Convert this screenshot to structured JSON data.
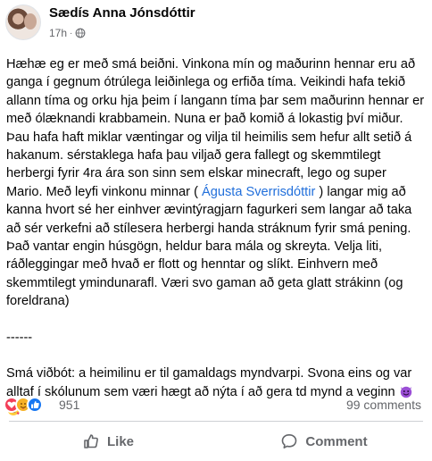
{
  "post": {
    "author": "Sædís Anna Jónsdóttir",
    "time": "17h",
    "dot": "·",
    "mention": "Águsta Sverrisdóttir",
    "text_before_mention": "Hæhæ eg er með smá beiðni. Vinkona mín og maðurinn hennar eru að ganga í gegnum ótrúlega leiðinlega og erfiða tíma. Veikindi hafa tekið allann tíma og orku hja þeim í langann tíma þar sem maðurinn hennar er með ólæknandi krabbamein. Nuna er það komið á lokastig því miður. Þau hafa haft miklar væntingar og vilja til heimilis sem hefur allt setið á hakanum. sérstaklega hafa þau viljað gera fallegt og skemmtilegt herbergi fyrir 4ra ára son sinn sem elskar minecraft, lego og super Mario. Með leyfi vinkonu minnar (",
    "text_after_mention": ") langar mig að kanna hvort sé her einhver ævintýragjarn fagurkeri sem langar að taka að sér verkefni að stílesera herbergi handa stráknum fyrir smá pening. Það vantar engin húsgögn, heldur bara mála og skreyta. Velja liti, ráðleggingar með hvað er flott og henntar og slíkt. Einhvern með skemmtilegt ymindunarafl. Væri svo gaman að geta glatt strákinn (og foreldrana)",
    "separator": "------",
    "addendum": "Smá viðbót: a heimilinu er til gamaldags myndvarpi. Svona eins og var alltaf í skólunum sem væri hægt að nýta í að gera td mynd a veginn"
  },
  "reactions": {
    "count": "951",
    "types": [
      "love",
      "care",
      "like"
    ]
  },
  "comments_label": "99 comments",
  "actions": {
    "like": "Like",
    "comment": "Comment"
  },
  "colors": {
    "mention": "#216fdb",
    "secondary_text": "#65676b",
    "like_blue": "#1877f2",
    "love_red": "#f33e58"
  },
  "icons": [
    "globe-icon",
    "smiling-devil-emoji",
    "smiling-hearts-emoji",
    "like-icon",
    "comment-icon"
  ]
}
